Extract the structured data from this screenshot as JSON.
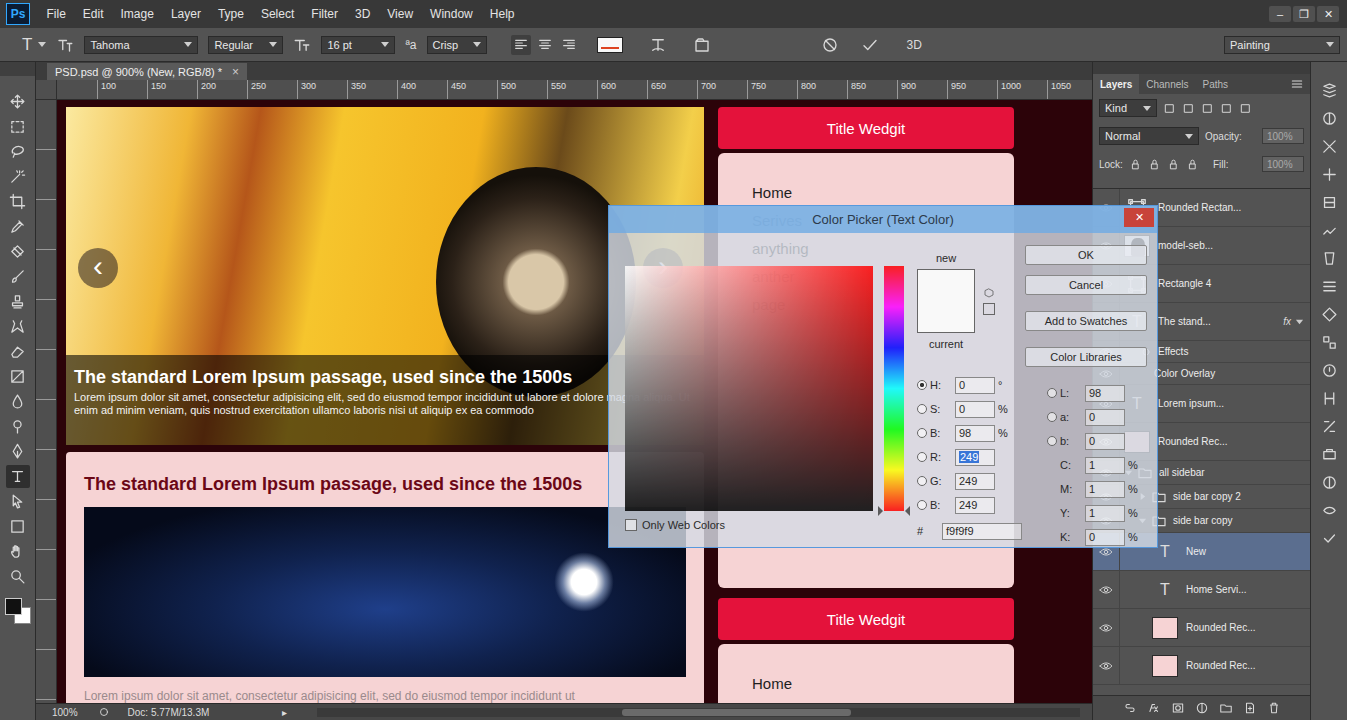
{
  "app": {
    "logo": "Ps"
  },
  "menu": [
    "File",
    "Edit",
    "Image",
    "Layer",
    "Type",
    "Select",
    "Filter",
    "3D",
    "View",
    "Window",
    "Help"
  ],
  "window_controls": [
    "–",
    "❐",
    "✕"
  ],
  "options_bar": {
    "tool_glyph": "T",
    "font_family": "Tahoma",
    "font_style": "Regular",
    "font_size": "16 pt",
    "aa": "ªa",
    "antialias": "Crisp",
    "alignment": [
      {
        "kind": "left",
        "selected": true
      },
      {
        "kind": "center",
        "selected": false
      },
      {
        "kind": "right",
        "selected": false
      }
    ],
    "text_color": "#f9f9f9",
    "three_d": "3D",
    "workspace": "Painting"
  },
  "document_tab": {
    "title": "PSD.psd @ 900% (New, RGB/8) *",
    "close": "×"
  },
  "ruler": {
    "ticks": [
      "100",
      "150",
      "200",
      "250",
      "300",
      "350",
      "400",
      "450",
      "500",
      "550",
      "600",
      "650",
      "700",
      "750",
      "800",
      "850",
      "900",
      "950",
      "1000",
      "1050"
    ]
  },
  "tools": [
    {
      "kind": "move",
      "selected": false
    },
    {
      "kind": "marquee",
      "selected": false
    },
    {
      "kind": "lasso",
      "selected": false
    },
    {
      "kind": "wand",
      "selected": false
    },
    {
      "kind": "crop",
      "selected": false
    },
    {
      "kind": "eyedropper",
      "selected": false
    },
    {
      "kind": "heal",
      "selected": false
    },
    {
      "kind": "brush",
      "selected": false
    },
    {
      "kind": "stamp",
      "selected": false
    },
    {
      "kind": "history",
      "selected": false
    },
    {
      "kind": "eraser",
      "selected": false
    },
    {
      "kind": "gradient",
      "selected": false
    },
    {
      "kind": "blur",
      "selected": false
    },
    {
      "kind": "dodge",
      "selected": false
    },
    {
      "kind": "pen",
      "selected": false
    },
    {
      "kind": "type",
      "selected": true
    },
    {
      "kind": "path",
      "selected": false
    },
    {
      "kind": "shape",
      "selected": false
    },
    {
      "kind": "hand",
      "selected": false
    },
    {
      "kind": "zoom",
      "selected": false
    }
  ],
  "colors": {
    "foreground": "#111111",
    "background": "#ffffff"
  },
  "canvas": {
    "slider": {
      "prev": "‹",
      "next": "›",
      "title": "The standard Lorem Ipsum passage, used since the 1500s",
      "text": "Lorem ipsum dolor sit amet, consectetur adipisicing elit, sed do eiusmod tempor incididunt ut labore et dolore magna aliqua. Ut enim ad minim veniam, quis nostrud exercitation ullamco laboris nisi ut aliquip ex ea commodo"
    },
    "post": {
      "title": "The standard Lorem Ipsum passage, used since the 1500s",
      "text": "Lorem ipsum dolor sit amet, consectetur adipisicing elit, sed do eiusmod tempor incididunt ut"
    },
    "widgets": [
      {
        "title": "Title Wedgit",
        "items": [
          "Home",
          "Serives",
          "anything",
          "anther",
          "page"
        ]
      },
      {
        "title": "Title Wedgit",
        "items": [
          "Home"
        ]
      }
    ]
  },
  "color_picker": {
    "title": "Color Picker (Text Color)",
    "close": "✕",
    "new_label": "new",
    "current_label": "current",
    "new_color": "#f9f9f9",
    "current_color": "#f9f9f9",
    "hue_color": "#ff0000",
    "hue": {
      "level": 0
    },
    "buttons": [
      "OK",
      "Cancel",
      "Add to Swatches",
      "Color Libraries"
    ],
    "fields": [
      {
        "label": "H:",
        "value": "0",
        "unit": "°",
        "selected": true,
        "focused": false
      },
      {
        "label": "S:",
        "value": "0",
        "unit": "%",
        "selected": false,
        "focused": false
      },
      {
        "label": "B:",
        "value": "98",
        "unit": "%",
        "selected": false,
        "focused": false
      },
      {
        "label": "R:",
        "value": "249",
        "unit": "",
        "selected": false,
        "focused": true
      },
      {
        "label": "G:",
        "value": "249",
        "unit": "",
        "selected": false,
        "focused": false
      },
      {
        "label": "B:",
        "value": "249",
        "unit": "",
        "selected": false,
        "focused": false
      }
    ],
    "lab_fields": [
      {
        "label": "L:",
        "value": "98",
        "selected": false
      },
      {
        "label": "a:",
        "value": "0",
        "selected": false
      },
      {
        "label": "b:",
        "value": "0",
        "selected": false
      }
    ],
    "cmyk_fields": [
      {
        "label": "C:",
        "value": "1",
        "unit": "%"
      },
      {
        "label": "M:",
        "value": "1",
        "unit": "%"
      },
      {
        "label": "Y:",
        "value": "1",
        "unit": "%"
      },
      {
        "label": "K:",
        "value": "0",
        "unit": "%"
      }
    ],
    "hex_label": "#",
    "hex": "f9f9f9",
    "web_colors": {
      "label": "Only Web Colors",
      "checked": false
    }
  },
  "layers_panel": {
    "tabs": [
      {
        "label": "Layers",
        "selected": true
      },
      {
        "label": "Channels",
        "selected": false
      },
      {
        "label": "Paths",
        "selected": false
      }
    ],
    "filter": "Kind",
    "blend": "Normal",
    "opacity_label": "Opacity:",
    "opacity": "100%",
    "lock_label": "Lock:",
    "fill_label": "Fill:",
    "fill": "100%",
    "layers": [
      {
        "name": "Rounded Rectan...",
        "kind": "vector",
        "depth": 0,
        "visible": true,
        "selected": false
      },
      {
        "name": "model-seb...",
        "kind": "raster",
        "depth": 0,
        "visible": true,
        "selected": false
      },
      {
        "name": "Rectangle 4",
        "kind": "vector",
        "depth": 0,
        "visible": true,
        "selected": false
      },
      {
        "name": "The stand...",
        "kind": "text",
        "thumb": "T",
        "fx": "fx",
        "expanded": true,
        "depth": 0,
        "visible": true,
        "selected": false
      },
      {
        "name": "Effects",
        "kind": "effects",
        "depth": 0,
        "visible": true,
        "selected": false
      },
      {
        "name": "Color Overlay",
        "kind": "effect",
        "depth": 0,
        "visible": true,
        "selected": false
      },
      {
        "name": "Lorem ipsum...",
        "kind": "text",
        "thumb": "T",
        "depth": 0,
        "visible": true,
        "selected": false
      },
      {
        "name": "Rounded Rec...",
        "kind": "shape",
        "color": "#f6d3d4",
        "depth": 0,
        "visible": true,
        "selected": false
      },
      {
        "name": "all sidebar",
        "kind": "group",
        "expanded": true,
        "depth": 0,
        "visible": true,
        "selected": false
      },
      {
        "name": "side bar copy 2",
        "kind": "group",
        "expanded": false,
        "depth": 1,
        "visible": true,
        "selected": false
      },
      {
        "name": "side bar copy",
        "kind": "group",
        "expanded": true,
        "depth": 1,
        "visible": true,
        "selected": false
      },
      {
        "name": "New",
        "kind": "text",
        "thumb": "T",
        "depth": 2,
        "visible": true,
        "selected": true
      },
      {
        "name": "Home Servi...",
        "kind": "text",
        "thumb": "T",
        "depth": 2,
        "visible": true,
        "selected": false
      },
      {
        "name": "Rounded Rec...",
        "kind": "shape",
        "color": "#f6d3d4",
        "depth": 2,
        "visible": true,
        "selected": false
      },
      {
        "name": "Rounded Rec...",
        "kind": "shape",
        "color": "#f6d3d4",
        "depth": 2,
        "visible": true,
        "selected": false
      }
    ]
  },
  "status_bar": {
    "zoom": "100%",
    "doc": "Doc: 5.77M/13.3M",
    "arrow": "▸"
  }
}
